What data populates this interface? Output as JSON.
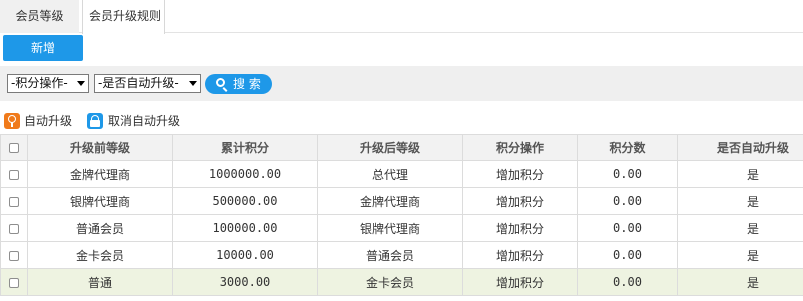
{
  "tabs": [
    {
      "label": "会员等级"
    },
    {
      "label": "会员升级规则"
    }
  ],
  "toolbar": {
    "add_label": "新增"
  },
  "filters": {
    "points_op_select": "-积分操作-",
    "auto_upgrade_select": "-是否自动升级-",
    "search_label": "搜 索"
  },
  "actions": {
    "auto_upgrade_label": "自动升级",
    "cancel_auto_upgrade_label": "取消自动升级"
  },
  "table": {
    "headers": [
      "升级前等级",
      "累计积分",
      "升级后等级",
      "积分操作",
      "积分数",
      "是否自动升级"
    ],
    "rows": [
      {
        "from_level": "金牌代理商",
        "accumulated_points": "1000000.00",
        "to_level": "总代理",
        "points_op": "增加积分",
        "points": "0.00",
        "auto_upgrade": "是"
      },
      {
        "from_level": "银牌代理商",
        "accumulated_points": "500000.00",
        "to_level": "金牌代理商",
        "points_op": "增加积分",
        "points": "0.00",
        "auto_upgrade": "是"
      },
      {
        "from_level": "普通会员",
        "accumulated_points": "100000.00",
        "to_level": "银牌代理商",
        "points_op": "增加积分",
        "points": "0.00",
        "auto_upgrade": "是"
      },
      {
        "from_level": "金卡会员",
        "accumulated_points": "10000.00",
        "to_level": "普通会员",
        "points_op": "增加积分",
        "points": "0.00",
        "auto_upgrade": "是"
      },
      {
        "from_level": "普通",
        "accumulated_points": "3000.00",
        "to_level": "金卡会员",
        "points_op": "增加积分",
        "points": "0.00",
        "auto_upgrade": "是"
      }
    ]
  },
  "colors": {
    "accent": "#1e98e8",
    "auto_icon": "#f07a1a",
    "highlight_row": "#eef3e1"
  }
}
